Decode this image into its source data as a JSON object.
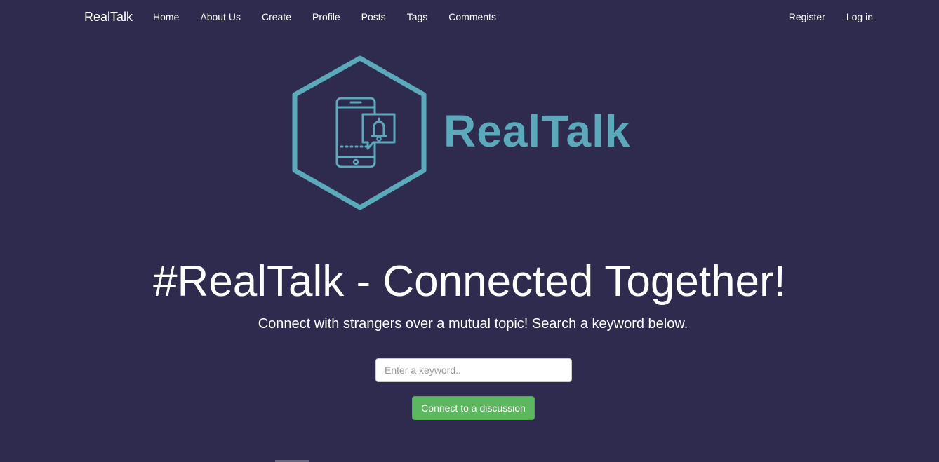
{
  "navbar": {
    "brand": "RealTalk",
    "left_links": [
      "Home",
      "About Us",
      "Create",
      "Profile",
      "Posts",
      "Tags",
      "Comments"
    ],
    "right_links": [
      "Register",
      "Log in"
    ]
  },
  "logo": {
    "text": "RealTalk",
    "icon": "hexagon-phone-bell-icon",
    "color": "#5aaabb"
  },
  "hero": {
    "headline": "#RealTalk - Connected Together!",
    "subhead": "Connect with strangers over a mutual topic! Search a keyword below."
  },
  "search": {
    "placeholder": "Enter a keyword..",
    "value": ""
  },
  "connect_button": {
    "label": "Connect to a discussion",
    "color": "#5cb85c"
  },
  "colors": {
    "background": "#2f2b4f",
    "text": "#ffffff",
    "accent": "#5aaabb"
  }
}
